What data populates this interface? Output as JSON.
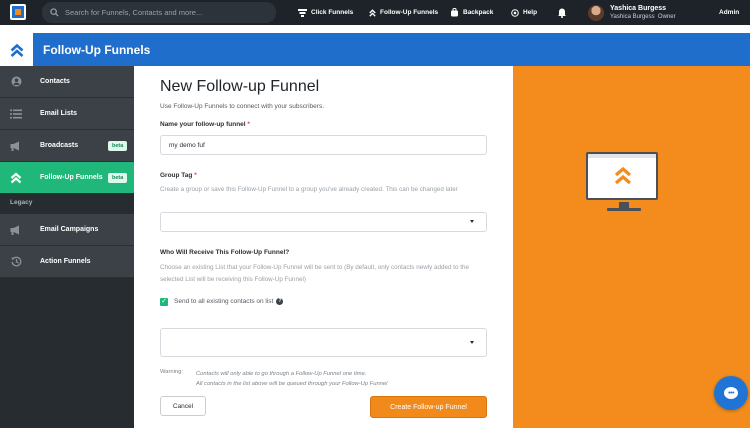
{
  "topbar": {
    "search_placeholder": "Search for Funnels, Contacts and more...",
    "nav": {
      "click_funnels": "Click Funnels",
      "follow_up_funnels": "Follow-Up Funnels",
      "backpack": "Backpack",
      "help": "Help",
      "admin": "Admin"
    },
    "user": {
      "name": "Yashica Burgess",
      "name_short": "Yashica Burgess",
      "role": "Owner"
    }
  },
  "header": {
    "title": "Follow-Up Funnels"
  },
  "sidebar": {
    "items": [
      {
        "label": "Contacts",
        "icon": "user-circle-icon"
      },
      {
        "label": "Email Lists",
        "icon": "list-icon"
      },
      {
        "label": "Broadcasts",
        "icon": "megaphone-icon",
        "badge": "beta"
      },
      {
        "label": "Follow-Up Funnels",
        "icon": "double-chevron-up-icon",
        "badge": "beta",
        "active": true
      }
    ],
    "legacy_heading": "Legacy",
    "legacy_items": [
      {
        "label": "Email Campaigns",
        "icon": "megaphone-icon"
      },
      {
        "label": "Action Funnels",
        "icon": "history-icon"
      }
    ]
  },
  "form": {
    "title": "New Follow-up Funnel",
    "subtitle": "Use Follow-Up Funnels to connect with your subscribers.",
    "name_label": "Name your follow-up funnel",
    "name_value": "my demo fuf",
    "group_label": "Group Tag",
    "group_help": "Create a group or save this Follow-Up Funnel to a group you've already created. This can be changed later",
    "group_value": "",
    "receive_label": "Who Will Receive This Follow-Up Funnel?",
    "receive_help": "Choose an existing List that your Follow-Up Funnel will be sent to (By default, only contacts newly added to the selected List will be receiving this Follow-Up Funnel)",
    "send_all_label": "Send to all existing contacts on list",
    "send_all_checked": true,
    "list_value": "",
    "warning_key": "Warning:",
    "warning_line1": "Contacts will only able to go through a Follow-Up Funnel one time.",
    "warning_line2": "All contacts in the list above will be queued through your Follow-Up Funnel",
    "cancel_label": "Cancel",
    "create_label": "Create Follow-up Funnel"
  },
  "colors": {
    "brand_blue": "#1f6ecb",
    "accent_orange": "#f38c1c",
    "active_green": "#1fb87a",
    "sidebar_bg": "#272c31",
    "topbar_bg": "#1d2329"
  }
}
